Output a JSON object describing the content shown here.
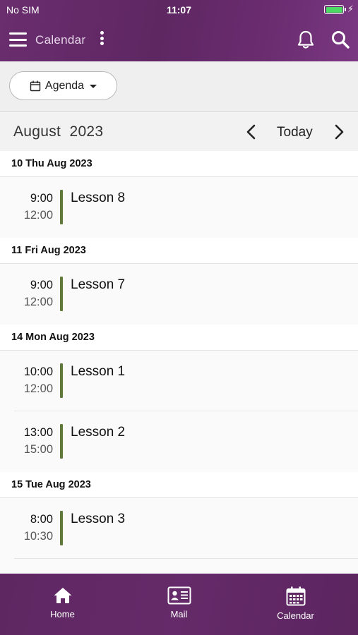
{
  "status": {
    "carrier": "No SIM",
    "time": "11:07",
    "battery_color": "#4cd964"
  },
  "header": {
    "title": "Calendar",
    "icons": [
      "menu-icon",
      "more-vertical-icon",
      "bell-icon",
      "search-icon"
    ]
  },
  "view_selector": {
    "label": "Agenda"
  },
  "month_nav": {
    "month": "August",
    "year": "2023",
    "today_label": "Today"
  },
  "days": [
    {
      "date": "10 Thu Aug 2023",
      "events": [
        {
          "start": "9:00",
          "end": "12:00",
          "title": "Lesson 8"
        }
      ]
    },
    {
      "date": "11 Fri Aug 2023",
      "events": [
        {
          "start": "9:00",
          "end": "12:00",
          "title": "Lesson 7"
        }
      ]
    },
    {
      "date": "14 Mon Aug 2023",
      "events": [
        {
          "start": "10:00",
          "end": "12:00",
          "title": "Lesson 1"
        },
        {
          "start": "13:00",
          "end": "15:00",
          "title": "Lesson 2"
        }
      ]
    },
    {
      "date": "15 Tue Aug 2023",
      "events": [
        {
          "start": "8:00",
          "end": "10:30",
          "title": "Lesson 3"
        }
      ]
    }
  ],
  "bottom_nav": {
    "home": "Home",
    "mail": "Mail",
    "calendar": "Calendar"
  },
  "colors": {
    "brand": "#5e2762",
    "event_bar": "#5f7a3a"
  }
}
